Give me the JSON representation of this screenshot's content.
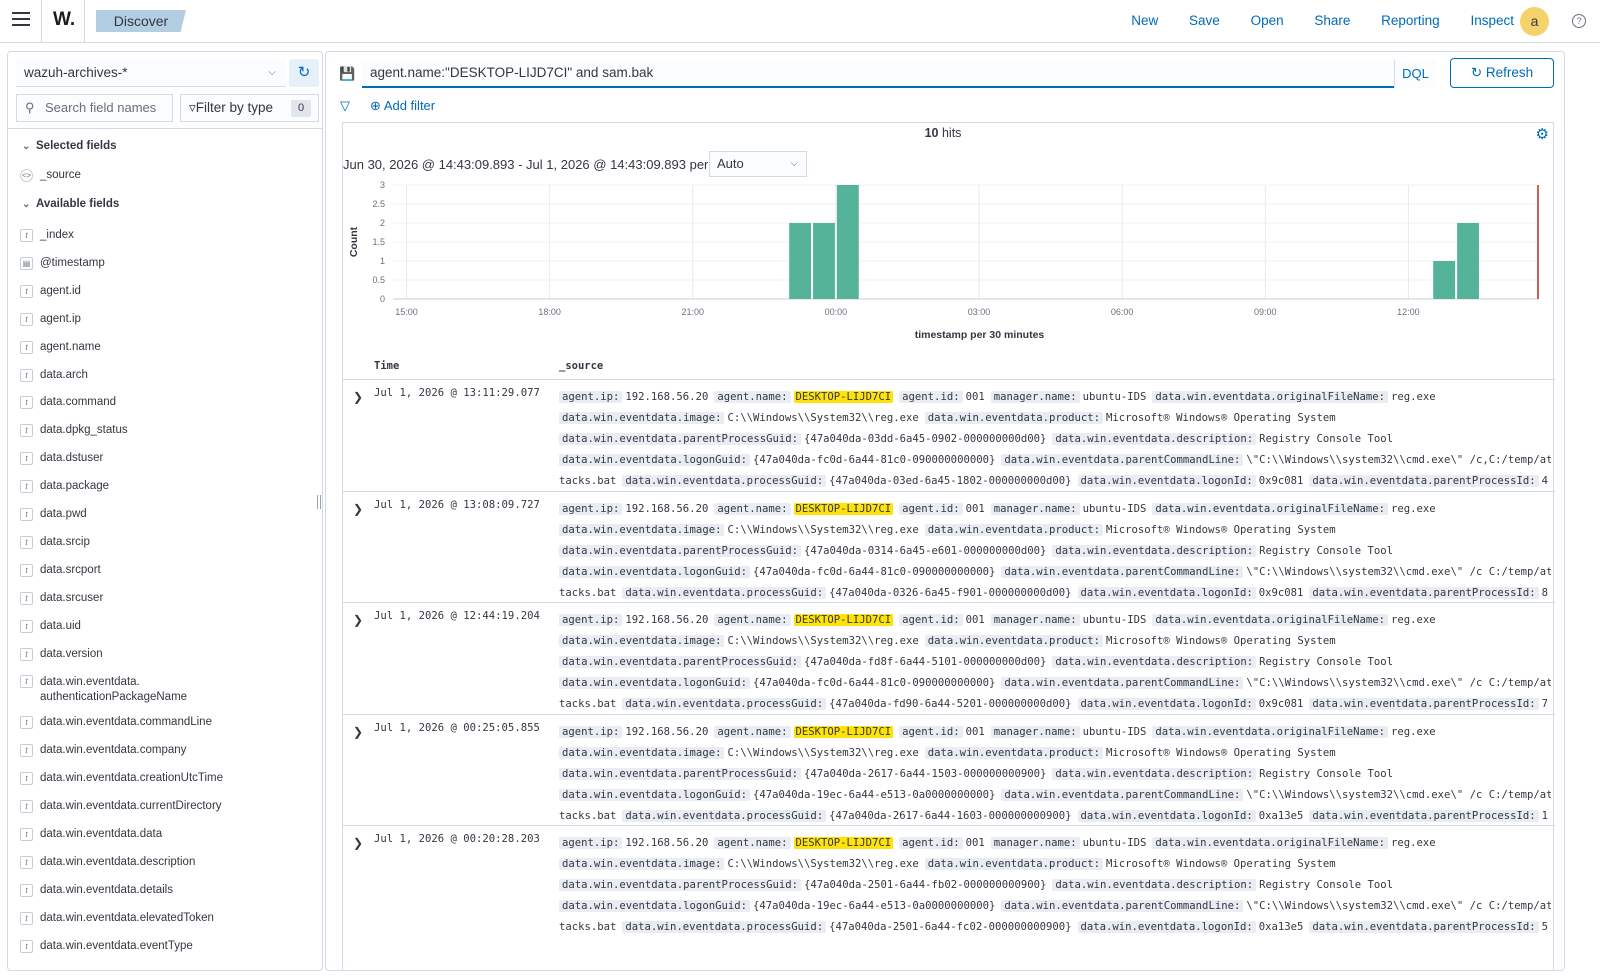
{
  "topbar": {
    "logo": "W.",
    "breadcrumb": "Discover",
    "links": [
      "New",
      "Save",
      "Open",
      "Share",
      "Reporting",
      "Inspect"
    ],
    "avatar_letter": "a",
    "help_glyph": "?"
  },
  "sidebar": {
    "index_pattern": "wazuh-archives-*",
    "search_placeholder": "Search field names",
    "filter_by_type": "Filter by type",
    "filter_count": "0",
    "selected_title": "Selected fields",
    "selected_fields": [
      "_source"
    ],
    "available_title": "Available fields",
    "available_fields": [
      {
        "name": "_index",
        "type": "t"
      },
      {
        "name": "@timestamp",
        "type": "date"
      },
      {
        "name": "agent.id",
        "type": "t"
      },
      {
        "name": "agent.ip",
        "type": "t"
      },
      {
        "name": "agent.name",
        "type": "t"
      },
      {
        "name": "data.arch",
        "type": "t"
      },
      {
        "name": "data.command",
        "type": "t"
      },
      {
        "name": "data.dpkg_status",
        "type": "t"
      },
      {
        "name": "data.dstuser",
        "type": "t"
      },
      {
        "name": "data.package",
        "type": "t"
      },
      {
        "name": "data.pwd",
        "type": "t"
      },
      {
        "name": "data.srcip",
        "type": "t"
      },
      {
        "name": "data.srcport",
        "type": "t"
      },
      {
        "name": "data.srcuser",
        "type": "t"
      },
      {
        "name": "data.uid",
        "type": "t"
      },
      {
        "name": "data.version",
        "type": "t"
      },
      {
        "name": "data.win.eventdata.\nauthenticationPackageName",
        "type": "t"
      },
      {
        "name": "data.win.eventdata.commandLine",
        "type": "t"
      },
      {
        "name": "data.win.eventdata.company",
        "type": "t"
      },
      {
        "name": "data.win.eventdata.creationUtcTime",
        "type": "t"
      },
      {
        "name": "data.win.eventdata.currentDirectory",
        "type": "t"
      },
      {
        "name": "data.win.eventdata.data",
        "type": "t"
      },
      {
        "name": "data.win.eventdata.description",
        "type": "t"
      },
      {
        "name": "data.win.eventdata.details",
        "type": "t"
      },
      {
        "name": "data.win.eventdata.elevatedToken",
        "type": "t"
      },
      {
        "name": "data.win.eventdata.eventType",
        "type": "t"
      }
    ]
  },
  "query": {
    "text": "agent.name:\"DESKTOP-LIJD7CI\" and sam.bak",
    "language": "DQL",
    "refresh_label": "Refresh",
    "add_filter": "Add filter"
  },
  "results": {
    "hits_count": "10",
    "hits_word": "hits",
    "time_range": "Jun 30, 2026 @ 14:43:09.893 - Jul 1, 2026 @ 14:43:09.893 per",
    "interval": "Auto",
    "col_time": "Time",
    "col_source": "_source"
  },
  "chart_data": {
    "type": "bar",
    "xlabel": "timestamp per 30 minutes",
    "ylabel": "Count",
    "ylim": [
      0,
      3
    ],
    "yticks": [
      "0",
      "0.5",
      "1",
      "1.5",
      "2",
      "2.5",
      "3"
    ],
    "xticks": [
      "15:00",
      "18:00",
      "21:00",
      "00:00",
      "03:00",
      "06:00",
      "09:00",
      "12:00"
    ],
    "color": "#54b399",
    "bars": [
      {
        "time": "23:00",
        "value": 2
      },
      {
        "time": "23:30",
        "value": 2
      },
      {
        "time": "00:00",
        "value": 3
      },
      {
        "time": "12:30",
        "value": 1
      },
      {
        "time": "13:00",
        "value": 2
      }
    ]
  },
  "rows": [
    {
      "time": "Jul 1, 2026 @ 13:11:29.077",
      "creator_guid": "{47a040da-03dd-6a45-0902-000000000d00}",
      "logon_guid": "{47a040da-fc0d-6a44-81c0-090000000000}",
      "cmdline": "\\\"C:\\\\Windows\\\\system32\\\\cmd.exe\\\" /c,C:/temp/at",
      "process_guid": "{47a040da-03ed-6a45-1802-000000000d00}",
      "logon_id": "0x9c081",
      "parent_pid": "4"
    },
    {
      "time": "Jul 1, 2026 @ 13:08:09.727",
      "creator_guid": "{47a040da-0314-6a45-e601-000000000d00}",
      "logon_guid": "{47a040da-fc0d-6a44-81c0-090000000000}",
      "cmdline": "\\\"C:\\\\Windows\\\\system32\\\\cmd.exe\\\" /c C:/temp/at",
      "process_guid": "{47a040da-0326-6a45-f901-000000000d00}",
      "logon_id": "0x9c081",
      "parent_pid": "8"
    },
    {
      "time": "Jul 1, 2026 @ 12:44:19.204",
      "creator_guid": "{47a040da-fd8f-6a44-5101-000000000d00}",
      "logon_guid": "{47a040da-fc0d-6a44-81c0-090000000000}",
      "cmdline": "\\\"C:\\\\Windows\\\\system32\\\\cmd.exe\\\" /c C:/temp/at",
      "process_guid": "{47a040da-fd90-6a44-5201-000000000d00}",
      "logon_id": "0x9c081",
      "parent_pid": "7"
    },
    {
      "time": "Jul 1, 2026 @ 00:25:05.855",
      "creator_guid": "{47a040da-2617-6a44-1503-000000000900}",
      "logon_guid": "{47a040da-19ec-6a44-e513-0a0000000000}",
      "cmdline": "\\\"C:\\\\Windows\\\\system32\\\\cmd.exe\\\" /c C:/temp/at",
      "process_guid": "{47a040da-2617-6a44-1603-000000000900}",
      "logon_id": "0xa13e5",
      "parent_pid": "1"
    },
    {
      "time": "Jul 1, 2026 @ 00:20:28.203",
      "creator_guid": "{47a040da-2501-6a44-fb02-000000000900}",
      "logon_guid": "{47a040da-19ec-6a44-e513-0a0000000000}",
      "cmdline": "\\\"C:\\\\Windows\\\\system32\\\\cmd.exe\\\" /c C:/temp/at",
      "process_guid": "{47a040da-2501-6a44-fc02-000000000900}",
      "logon_id": "0xa13e5",
      "parent_pid": "5"
    }
  ],
  "row_common": {
    "agent_ip_k": "agent.ip:",
    "agent_ip": "192.168.56.20",
    "agent_name_k": "agent.name:",
    "agent_name": "DESKTOP-LIJD7CI",
    "agent_id_k": "agent.id:",
    "agent_id": "001",
    "manager_k": "manager.name:",
    "manager": "ubuntu-IDS",
    "orig_k": "data.win.eventdata.originalFileName:",
    "orig": "reg.exe",
    "image_k": "data.win.eventdata.image:",
    "image": "C:\\\\Windows\\\\System32\\\\reg.exe",
    "product_k": "data.win.eventdata.product:",
    "product": "Microsoft® Windows® Operating System",
    "pguid_k": "data.win.eventdata.parentProcessGuid:",
    "desc_k": "data.win.eventdata.description:",
    "desc": "Registry Console Tool",
    "lguid_k": "data.win.eventdata.logonGuid:",
    "pcmd_k": "data.win.eventdata.parentCommandLine:",
    "cont": "tacks.bat",
    "prguid_k": "data.win.eventdata.processGuid:",
    "logonid_k": "data.win.eventdata.logonId:",
    "ppid_k": "data.win.eventdata.parentProcessId:"
  }
}
